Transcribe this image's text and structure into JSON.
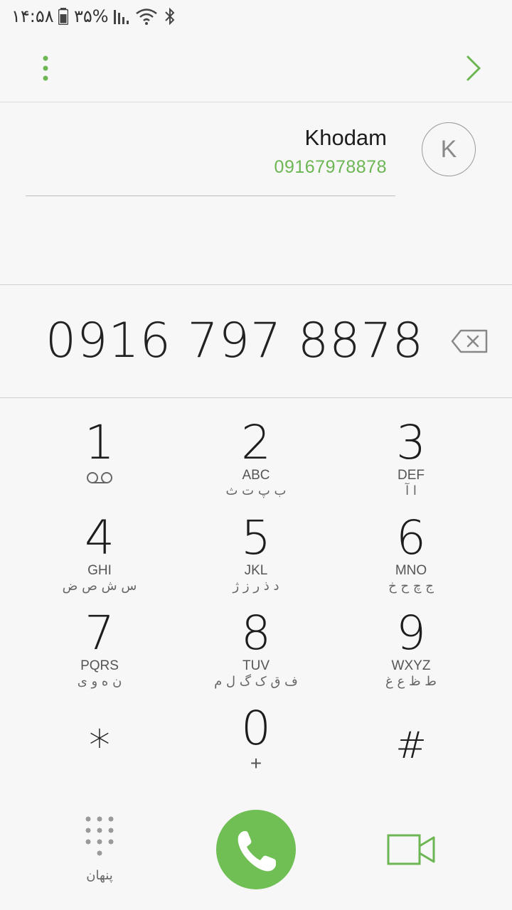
{
  "status_bar": {
    "time": "۱۴:۵۸",
    "battery_percent": "۳۵%"
  },
  "top_bar": {
    "more_icon": "more-vertical-icon",
    "forward_icon": "chevron-right-icon"
  },
  "contact": {
    "name": "Khodam",
    "number": "09167978878",
    "avatar_initial": "K"
  },
  "dialed_number": "0916 797 8878",
  "keys": [
    {
      "digit": "1",
      "letters": "",
      "farsi": ""
    },
    {
      "digit": "2",
      "letters": "ABC",
      "farsi": "ب پ ت ث"
    },
    {
      "digit": "3",
      "letters": "DEF",
      "farsi": "ا آ"
    },
    {
      "digit": "4",
      "letters": "GHI",
      "farsi": "س ش ص ض"
    },
    {
      "digit": "5",
      "letters": "JKL",
      "farsi": "د ذ ر ز ژ"
    },
    {
      "digit": "6",
      "letters": "MNO",
      "farsi": "ج چ ح خ"
    },
    {
      "digit": "7",
      "letters": "PQRS",
      "farsi": "ن ه و ی"
    },
    {
      "digit": "8",
      "letters": "TUV",
      "farsi": "ف ق ک گ ل م"
    },
    {
      "digit": "9",
      "letters": "WXYZ",
      "farsi": "ط ظ ع غ"
    },
    {
      "digit": "*",
      "letters": "",
      "farsi": ""
    },
    {
      "digit": "0",
      "letters": "+",
      "farsi": ""
    },
    {
      "digit": "#",
      "letters": "",
      "farsi": ""
    }
  ],
  "bottom_bar": {
    "hide_keypad_label": "پنهان"
  },
  "colors": {
    "accent": "#6cb654",
    "call_button": "#6fbf55"
  }
}
